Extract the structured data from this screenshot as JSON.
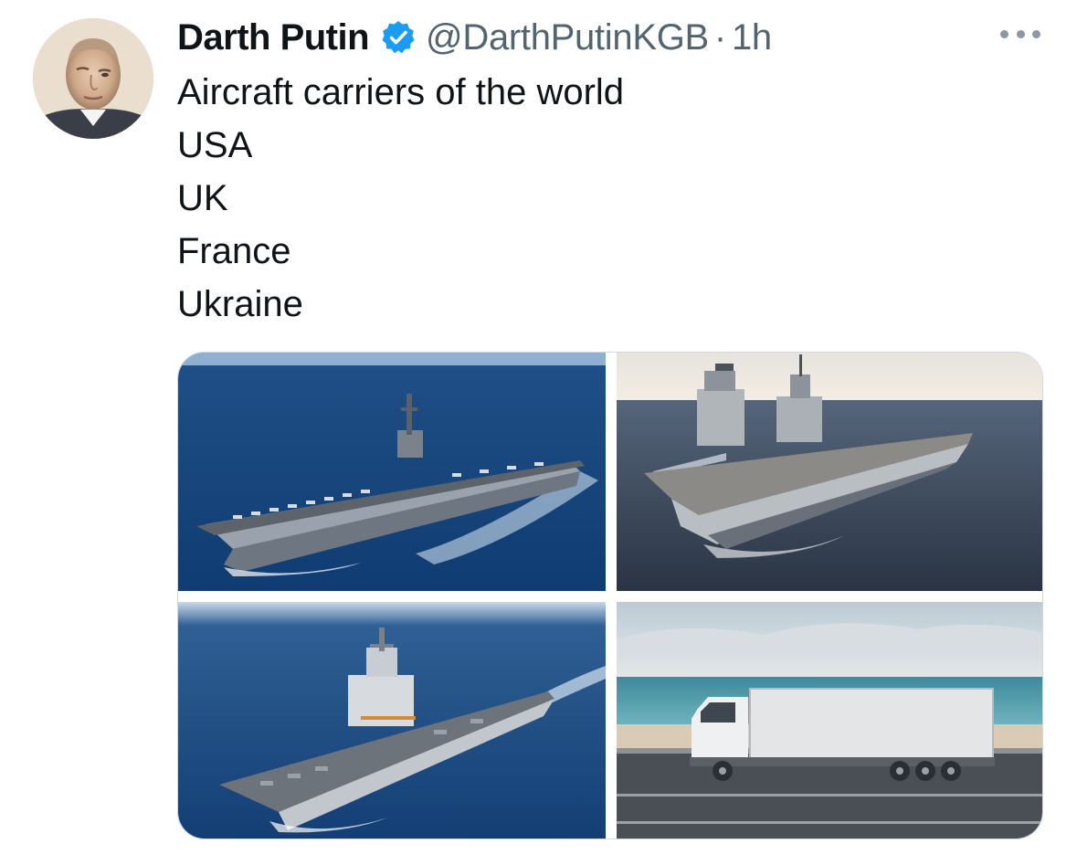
{
  "tweet": {
    "author": {
      "display_name": "Darth Putin",
      "handle": "@DarthPutinKGB",
      "verified": true,
      "verified_icon": "verified-badge-icon",
      "avatar_icon": "avatar-photo"
    },
    "separator": "·",
    "timestamp": "1h",
    "more_icon": "more-options-icon",
    "text_lines": [
      "Aircraft carriers of the world",
      "USA",
      "UK",
      "France",
      "Ukraine"
    ],
    "media": [
      {
        "subject": "aircraft-carrier-usa"
      },
      {
        "subject": "aircraft-carrier-uk"
      },
      {
        "subject": "aircraft-carrier-france"
      },
      {
        "subject": "delivery-truck"
      }
    ]
  },
  "colors": {
    "text_primary": "#0f1419",
    "text_secondary": "#536471",
    "verified_blue": "#1d9bf0",
    "border": "#cfd9de"
  }
}
